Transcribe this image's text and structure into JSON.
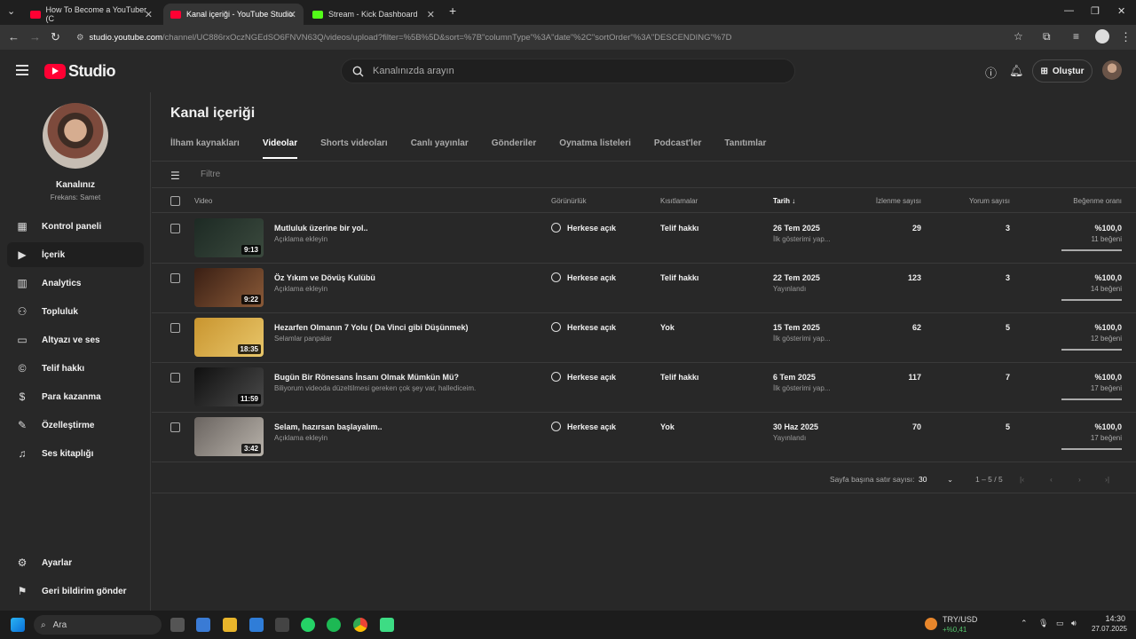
{
  "browser": {
    "tabs": [
      {
        "title": "How To Become a YouTuber (C",
        "favicon_color": "#ff0033"
      },
      {
        "title": "Kanal içeriği - YouTube Studio",
        "favicon_color": "#ff0033"
      },
      {
        "title": "Stream - Kick Dashboard",
        "favicon_color": "#53fc18"
      }
    ],
    "url_host": "studio.youtube.com",
    "url_path": "/channel/UC886rxOczNGEdSO6FNVN63Q/videos/upload?filter=%5B%5D&sort=%7B\"columnType\"%3A\"date\"%2C\"sortOrder\"%3A\"DESCENDING\"%7D"
  },
  "header": {
    "logo_text": "Studio",
    "search_placeholder": "Kanalınızda arayın",
    "create_label": "Oluştur"
  },
  "sidebar": {
    "channel_name": "Kanalınız",
    "channel_sub": "Frekans: Samet",
    "items": [
      {
        "label": "Kontrol paneli",
        "icon": "dashboard-icon"
      },
      {
        "label": "İçerik",
        "icon": "content-icon"
      },
      {
        "label": "Analytics",
        "icon": "analytics-icon"
      },
      {
        "label": "Topluluk",
        "icon": "community-icon"
      },
      {
        "label": "Altyazı ve ses",
        "icon": "subtitles-icon"
      },
      {
        "label": "Telif hakkı",
        "icon": "copyright-icon"
      },
      {
        "label": "Para kazanma",
        "icon": "monetization-icon"
      },
      {
        "label": "Özelleştirme",
        "icon": "customization-icon"
      },
      {
        "label": "Ses kitaplığı",
        "icon": "audio-library-icon"
      }
    ],
    "bottom_items": [
      {
        "label": "Ayarlar",
        "icon": "settings-icon"
      },
      {
        "label": "Geri bildirim gönder",
        "icon": "feedback-icon"
      }
    ]
  },
  "main": {
    "title": "Kanal içeriği",
    "tabs": [
      "İlham kaynakları",
      "Videolar",
      "Shorts videoları",
      "Canlı yayınlar",
      "Gönderiler",
      "Oynatma listeleri",
      "Podcast'ler",
      "Tanıtımlar"
    ],
    "active_tab": "Videolar",
    "filter_placeholder": "Filtre",
    "columns": {
      "video": "Video",
      "visibility": "Görünürlük",
      "restrictions": "Kısıtlamalar",
      "date": "Tarih",
      "views": "İzlenme sayısı",
      "comments": "Yorum sayısı",
      "likes": "Beğenme oranı"
    },
    "videos": [
      {
        "title": "Mutluluk üzerine bir yol..",
        "desc": "Açıklama ekleyin",
        "duration": "9:13",
        "visibility": "Herkese açık",
        "restriction": "Telif hakkı",
        "date": "26 Tem 2025",
        "date_status": "İlk gösterimi yap...",
        "views": "29",
        "comments": "3",
        "like_pct": "%100,0",
        "like_count": "11 beğeni",
        "like_ratio": 1.0,
        "thumb_colors": [
          "#1d2a24",
          "#3b4a3e"
        ]
      },
      {
        "title": "Öz Yıkım ve Dövüş Kulübü",
        "desc": "Açıklama ekleyin",
        "duration": "9:22",
        "visibility": "Herkese açık",
        "restriction": "Telif hakkı",
        "date": "22 Tem 2025",
        "date_status": "Yayınlandı",
        "views": "123",
        "comments": "3",
        "like_pct": "%100,0",
        "like_count": "14 beğeni",
        "like_ratio": 1.0,
        "thumb_colors": [
          "#3a1f14",
          "#8a5a38"
        ]
      },
      {
        "title": "Hezarfen Olmanın 7 Yolu ( Da Vinci gibi Düşünmek)",
        "desc": "Selamlar panpalar",
        "duration": "18:35",
        "visibility": "Herkese açık",
        "restriction": "Yok",
        "date": "15 Tem 2025",
        "date_status": "İlk gösterimi yap...",
        "views": "62",
        "comments": "5",
        "like_pct": "%100,0",
        "like_count": "12 beğeni",
        "like_ratio": 1.0,
        "thumb_colors": [
          "#c9952f",
          "#e8c66a"
        ]
      },
      {
        "title": "Bugün Bir Rönesans İnsanı Olmak Mümkün Mü?",
        "desc": "Biliyorum videoda düzeltilmesi gereken çok şey var, hallediceim.",
        "duration": "11:59",
        "visibility": "Herkese açık",
        "restriction": "Telif hakkı",
        "date": "6 Tem 2025",
        "date_status": "İlk gösterimi yap...",
        "views": "117",
        "comments": "7",
        "like_pct": "%100,0",
        "like_count": "17 beğeni",
        "like_ratio": 1.0,
        "thumb_colors": [
          "#101010",
          "#4a4a4a"
        ]
      },
      {
        "title": "Selam, hazırsan başlayalım..",
        "desc": "Açıklama ekleyin",
        "duration": "3:42",
        "visibility": "Herkese açık",
        "restriction": "Yok",
        "date": "30 Haz 2025",
        "date_status": "Yayınlandı",
        "views": "70",
        "comments": "5",
        "like_pct": "%100,0",
        "like_count": "17 beğeni",
        "like_ratio": 1.0,
        "thumb_colors": [
          "#6a6460",
          "#b8b2aa"
        ]
      }
    ],
    "pager": {
      "rows_label": "Sayfa başına satır sayısı:",
      "rows_value": "30",
      "range": "1 – 5 / 5"
    }
  },
  "taskbar": {
    "search_label": "Ara",
    "currency_pair": "TRY/USD",
    "currency_change": "+%0,41",
    "time": "14:30",
    "date": "27.07.2025"
  }
}
